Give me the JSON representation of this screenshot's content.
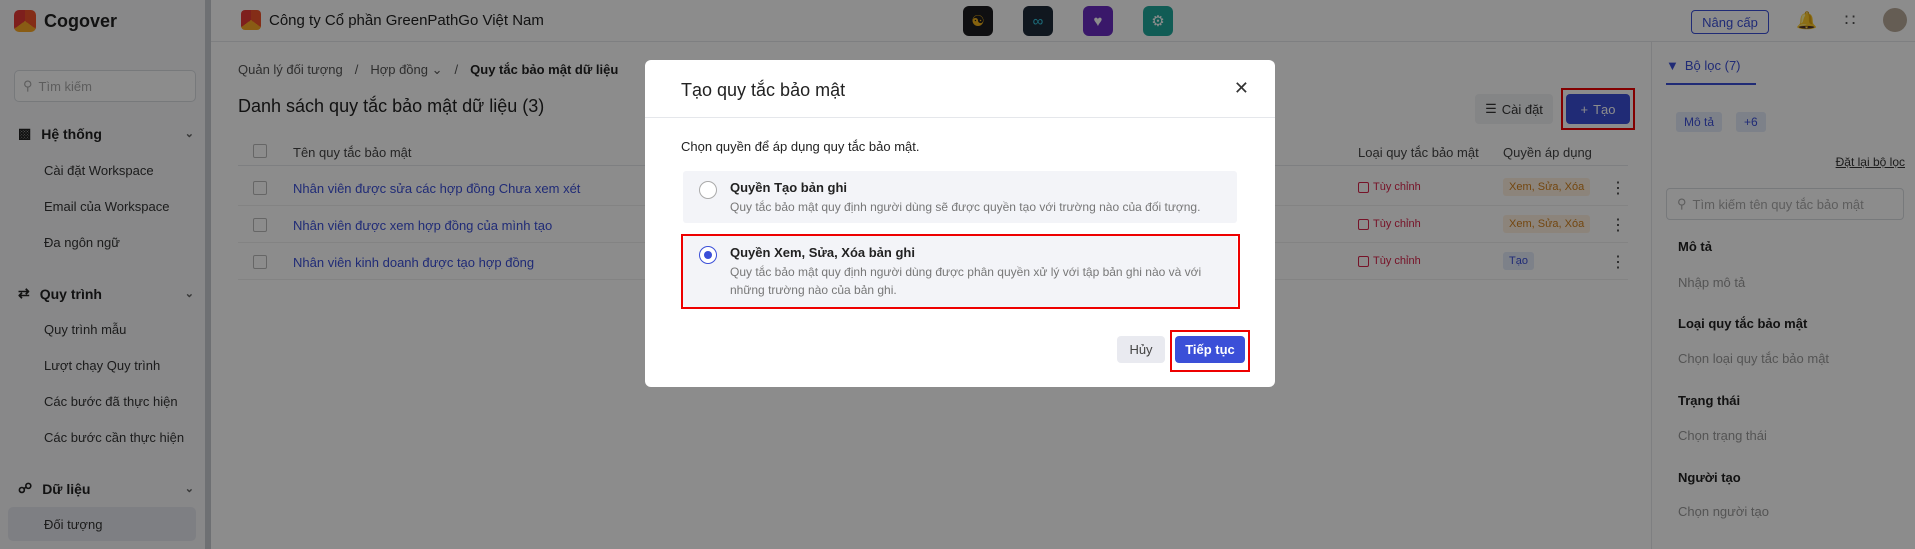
{
  "sidebar": {
    "brand": "Cogover",
    "search_placeholder": "Tìm kiếm",
    "groups": [
      {
        "label": "Hệ thống",
        "items": [
          "Cài đặt Workspace",
          "Email của Workspace",
          "Đa ngôn ngữ"
        ]
      },
      {
        "label": "Quy trình",
        "items": [
          "Quy trình mẫu",
          "Lượt chạy Quy trình",
          "Các bước đã thực hiện",
          "Các bước cần thực hiện"
        ]
      },
      {
        "label": "Dữ liệu",
        "items": [
          "Đối tượng"
        ]
      }
    ]
  },
  "topbar": {
    "company": "Công ty Cổ phần GreenPathGo Việt Nam",
    "upgrade": "Nâng cấp"
  },
  "breadcrumb": [
    "Quản lý đối tượng",
    "Hợp đồng",
    "Quy tắc bảo mật dữ liệu"
  ],
  "page": {
    "title": "Danh sách quy tắc bảo mật dữ liệu (3)",
    "settings": "Cài đặt",
    "create": "Tạo"
  },
  "table": {
    "columns": [
      "Tên quy tắc bảo mật",
      "Loại quy tắc bảo mật",
      "Quyền áp dụng"
    ],
    "rows": [
      {
        "name": "Nhân viên được sửa các hợp đồng Chưa xem xét",
        "type": "Tùy chỉnh",
        "perm": "Xem, Sửa, Xóa"
      },
      {
        "name": "Nhân viên được xem hợp đồng của mình tạo",
        "type": "Tùy chỉnh",
        "perm": "Xem, Sửa, Xóa"
      },
      {
        "name": "Nhân viên kinh doanh được tạo hợp đồng",
        "type": "Tùy chỉnh",
        "perm": "Tạo"
      }
    ]
  },
  "filter": {
    "tab": "Bộ lọc (7)",
    "tags": [
      "Mô tả",
      "+6"
    ],
    "reset": "Đặt lại bộ lọc",
    "search_placeholder": "Tìm kiếm tên quy tắc bảo mật",
    "fields": [
      {
        "label": "Mô tả",
        "placeholder": "Nhập mô tả"
      },
      {
        "label": "Loại quy tắc bảo mật",
        "placeholder": "Chọn loại quy tắc bảo mật"
      },
      {
        "label": "Trạng thái",
        "placeholder": "Chọn trạng thái"
      },
      {
        "label": "Người tạo",
        "placeholder": "Chọn người tạo"
      }
    ]
  },
  "modal": {
    "title": "Tạo quy tắc bảo mật",
    "intro": "Chọn quyền để áp dụng quy tắc bảo mật.",
    "options": [
      {
        "title": "Quyền Tạo bản ghi",
        "desc": "Quy tắc bảo mật quy định người dùng sẽ được quyền tạo với trường nào của đối tượng.",
        "selected": false
      },
      {
        "title": "Quyền Xem, Sửa, Xóa bản ghi",
        "desc": "Quy tắc bảo mật quy định người dùng được phân quyền xử lý với tập bản ghi nào và với những trường nào của bản ghi.",
        "selected": true
      }
    ],
    "cancel": "Hủy",
    "next": "Tiếp tục"
  },
  "colors": {
    "accent": "#3b4fd8",
    "highlight": "#e00000",
    "danger": "#d8234a"
  }
}
